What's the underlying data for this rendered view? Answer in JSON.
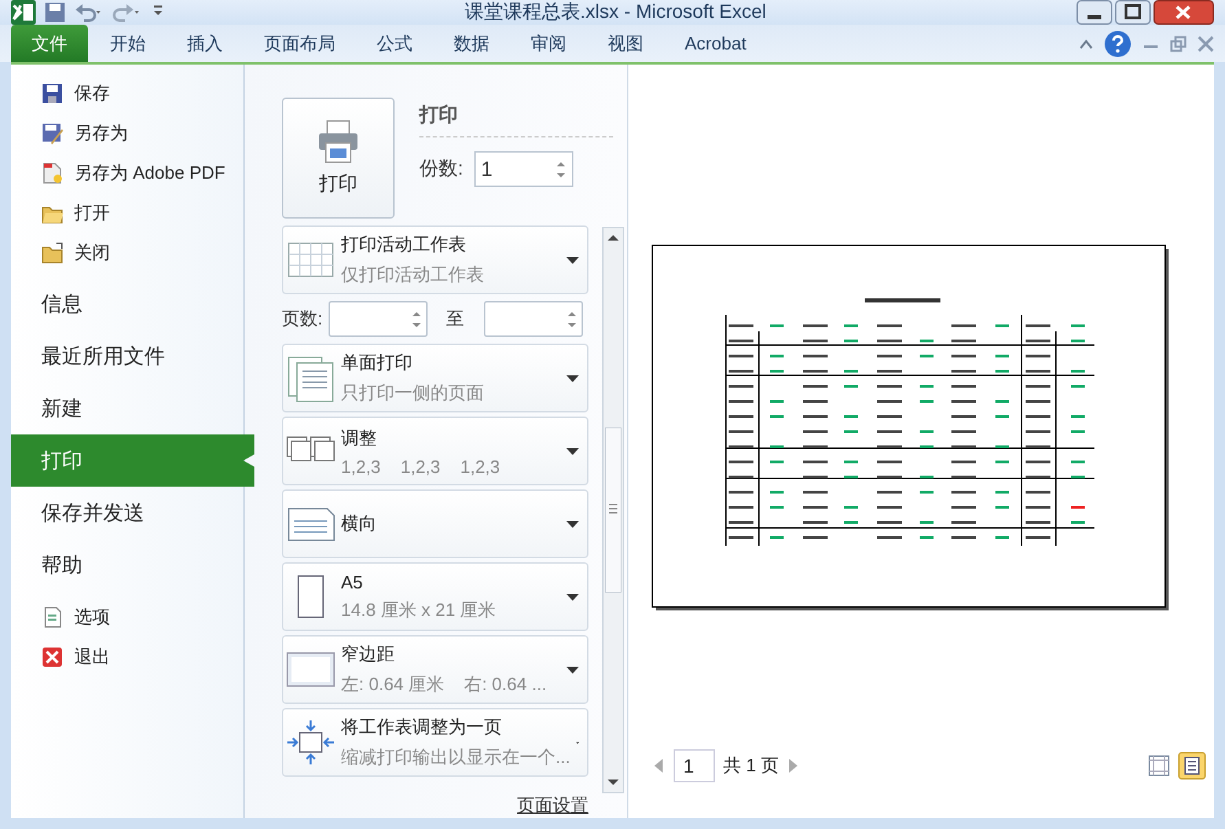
{
  "window": {
    "title": "课堂课程总表.xlsx - Microsoft Excel"
  },
  "ribbon": {
    "tabs": [
      {
        "label": "文件",
        "selected": true
      },
      {
        "label": "开始",
        "selected": false
      },
      {
        "label": "插入",
        "selected": false
      },
      {
        "label": "页面布局",
        "selected": false
      },
      {
        "label": "公式",
        "selected": false
      },
      {
        "label": "数据",
        "selected": false
      },
      {
        "label": "审阅",
        "selected": false
      },
      {
        "label": "视图",
        "selected": false
      },
      {
        "label": "Acrobat",
        "selected": false
      }
    ]
  },
  "menu": [
    {
      "kind": "command",
      "label": "保存",
      "selected": false
    },
    {
      "kind": "command",
      "label": "另存为",
      "selected": false
    },
    {
      "kind": "command",
      "label": "另存为 Adobe PDF",
      "selected": false
    },
    {
      "kind": "command",
      "label": "打开",
      "selected": false
    },
    {
      "kind": "command",
      "label": "关闭",
      "selected": false
    },
    {
      "kind": "section",
      "label": "信息",
      "selected": false
    },
    {
      "kind": "section",
      "label": "最近所用文件",
      "selected": false
    },
    {
      "kind": "section",
      "label": "新建",
      "selected": false
    },
    {
      "kind": "section",
      "label": "打印",
      "selected": true
    },
    {
      "kind": "section",
      "label": "保存并发送",
      "selected": false
    },
    {
      "kind": "section",
      "label": "帮助",
      "selected": false
    },
    {
      "kind": "command",
      "label": "选项",
      "selected": false
    },
    {
      "kind": "command",
      "label": "退出",
      "selected": false
    }
  ],
  "print": {
    "button": "打印",
    "heading": "打印",
    "copies": {
      "label": "份数:",
      "value": "1"
    },
    "settings": [
      {
        "kind": "dropdown",
        "title": "打印活动工作表",
        "subtitle": "仅打印活动工作表"
      },
      {
        "kind": "range",
        "label": "页数:",
        "to": "至"
      },
      {
        "kind": "dropdown",
        "title": "单面打印",
        "subtitle": "只打印一侧的页面"
      },
      {
        "kind": "dropdown",
        "title": "调整",
        "subtitle": "1,2,3    1,2,3    1,2,3"
      },
      {
        "kind": "dropdown",
        "title": "横向"
      },
      {
        "kind": "dropdown",
        "title": "A5",
        "subtitle": "14.8 厘米 x 21 厘米"
      },
      {
        "kind": "dropdown",
        "title": "窄边距",
        "subtitle": "左: 0.64 厘米    右: 0.64 ..."
      },
      {
        "kind": "dropdown",
        "title": "将工作表调整为一页",
        "subtitle": "缩减打印输出以显示在一个..."
      }
    ],
    "page_setup_link": "页面设置"
  },
  "preview": {
    "page": "1",
    "total": "共 1 页"
  }
}
